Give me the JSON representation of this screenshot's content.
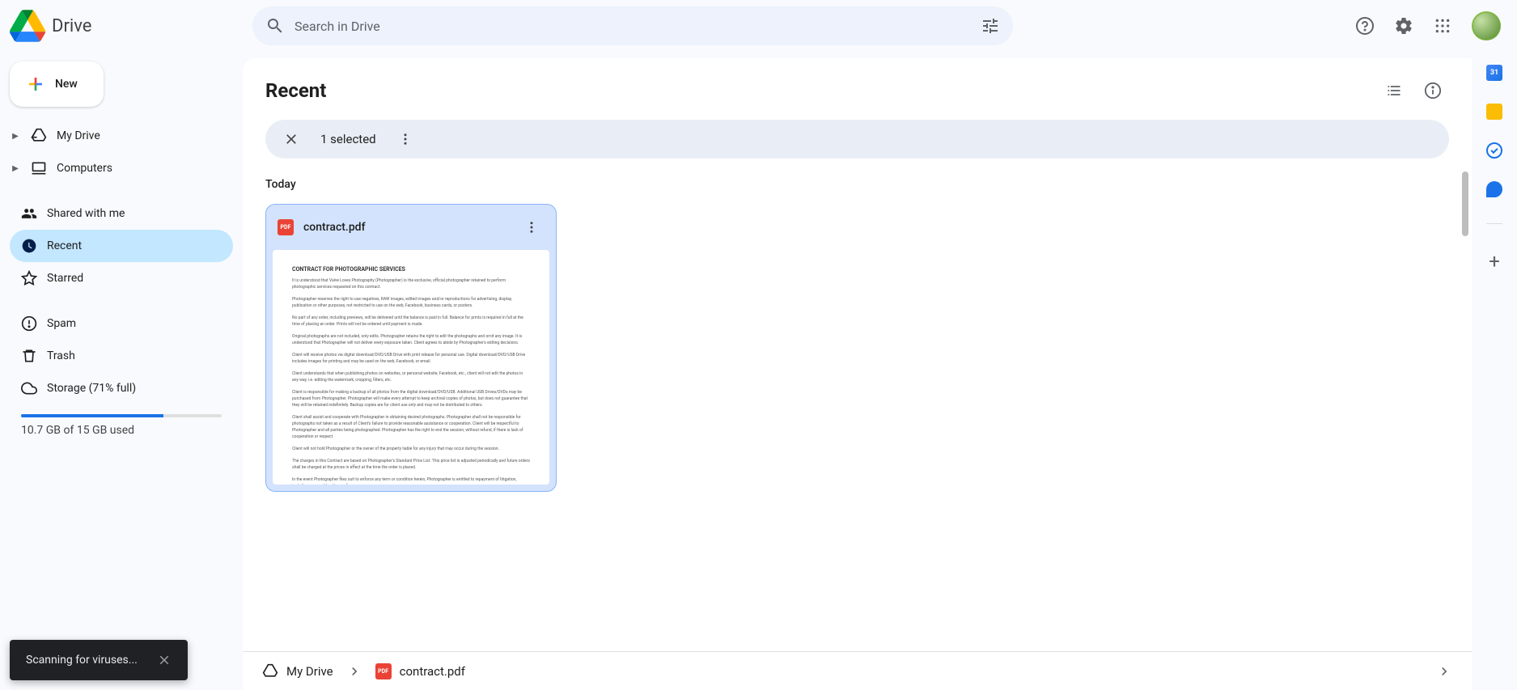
{
  "header": {
    "app_name": "Drive",
    "search_placeholder": "Search in Drive"
  },
  "sidebar": {
    "new_button": "New",
    "items": [
      {
        "label": "My Drive",
        "icon": "drive"
      },
      {
        "label": "Computers",
        "icon": "laptop"
      },
      {
        "label": "Shared with me",
        "icon": "people"
      },
      {
        "label": "Recent",
        "icon": "clock"
      },
      {
        "label": "Starred",
        "icon": "star"
      },
      {
        "label": "Spam",
        "icon": "spam"
      },
      {
        "label": "Trash",
        "icon": "trash"
      },
      {
        "label": "Storage (71% full)",
        "icon": "cloud"
      }
    ],
    "storage_text": "10.7 GB of 15 GB used",
    "storage_percent": 71
  },
  "main": {
    "title": "Recent",
    "selection_text": "1 selected",
    "section_label": "Today",
    "file": {
      "name": "contract.pdf",
      "type": "PDF",
      "thumb_heading": "CONTRACT FOR PHOTOGRAPHIC SERVICES"
    }
  },
  "breadcrumb": {
    "root": "My Drive",
    "current": "contract.pdf"
  },
  "toast": {
    "message": "Scanning for viruses..."
  },
  "rail": {
    "calendar_day": "31"
  }
}
